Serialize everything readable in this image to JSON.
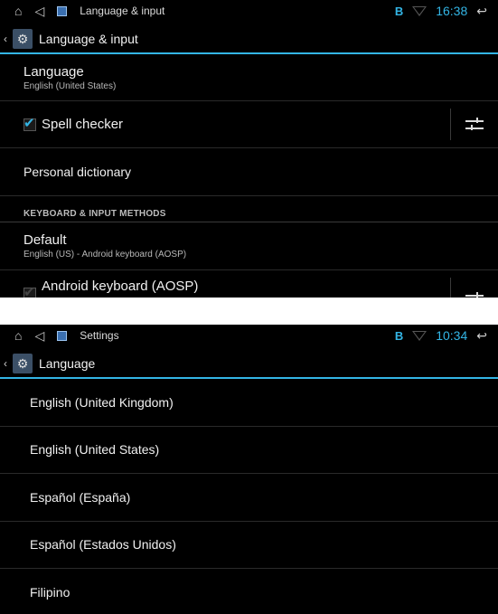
{
  "screen1": {
    "status": {
      "title": "Language & input",
      "time": "16:38"
    },
    "actionbar": {
      "title": "Language & input"
    },
    "language": {
      "title": "Language",
      "summary": "English (United States)"
    },
    "spell_checker": {
      "label": "Spell checker",
      "checked": true
    },
    "personal_dictionary": {
      "label": "Personal dictionary"
    },
    "keyboard_header": "KEYBOARD & INPUT METHODS",
    "default": {
      "title": "Default",
      "summary": "English (US) - Android keyboard (AOSP)"
    },
    "aosp": {
      "label": "Android keyboard (AOSP)",
      "checked": true
    }
  },
  "screen2": {
    "status": {
      "title": "Settings",
      "time": "10:34"
    },
    "actionbar": {
      "title": "Language"
    },
    "languages": [
      "English (United Kingdom)",
      "English (United States)",
      "Español (España)",
      "Español (Estados Unidos)",
      "Filipino"
    ]
  },
  "icons": {
    "home": "home-icon",
    "back": "back-triangle-icon",
    "bluetooth": "bluetooth-icon",
    "wifi": "wifi-icon",
    "return": "return-icon",
    "settings": "gear-icon",
    "sliders": "settings-sliders-icon"
  },
  "colors": {
    "accent": "#33b5e5",
    "background": "#000000",
    "app_icon": "#3b4f66"
  }
}
